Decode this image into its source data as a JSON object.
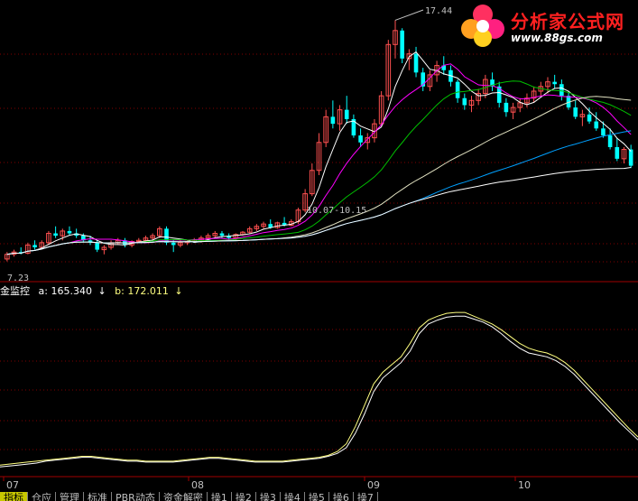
{
  "logo": {
    "title": "分析家公式网",
    "url": "www.88gs.com"
  },
  "indicator": {
    "name": "金监控",
    "a_label": "a:",
    "a_value": "165.340",
    "a_arrow": "↓",
    "b_label": "b:",
    "b_value": "172.011",
    "b_arrow": "↓"
  },
  "colors": {
    "up": "#ff5050",
    "down": "#00ffff",
    "ma_white": "#ffffff",
    "ma_magenta": "#ff00ff",
    "ma_green": "#00c000",
    "ma_blue": "#00a0ff",
    "ma_beige": "#e0e0c0",
    "ind_a": "#ffffff",
    "ind_b": "#ffff80",
    "grid": "#800000"
  },
  "bottom_tabs": [
    "指标",
    "仓应",
    "管理",
    "标准",
    "PBR动态",
    "资金解密",
    "操1",
    "操2",
    "操3",
    "操4",
    "操5",
    "操6",
    "操7"
  ],
  "active_tab": 0,
  "chart_data": {
    "type": "candlestick",
    "x_ticks": [
      "07",
      "08",
      "09",
      "10"
    ],
    "annotations": {
      "high": "17.44",
      "low": "7.23",
      "range": "10.07-10.15"
    },
    "price_ylim": [
      6.5,
      18.0
    ],
    "candles": [
      [
        7.2,
        7.5,
        7.1,
        7.4
      ],
      [
        7.4,
        7.6,
        7.3,
        7.5
      ],
      [
        7.5,
        7.7,
        7.4,
        7.45
      ],
      [
        7.45,
        7.9,
        7.4,
        7.8
      ],
      [
        7.8,
        8.0,
        7.6,
        7.7
      ],
      [
        7.7,
        8.0,
        7.6,
        7.9
      ],
      [
        7.9,
        8.4,
        7.8,
        8.3
      ],
      [
        8.3,
        8.6,
        8.1,
        8.2
      ],
      [
        8.2,
        8.5,
        8.0,
        8.4
      ],
      [
        8.4,
        8.6,
        8.2,
        8.3
      ],
      [
        8.3,
        8.5,
        8.1,
        8.2
      ],
      [
        8.2,
        8.3,
        7.9,
        8.0
      ],
      [
        8.0,
        8.2,
        7.8,
        7.9
      ],
      [
        7.9,
        8.0,
        7.5,
        7.6
      ],
      [
        7.6,
        7.8,
        7.4,
        7.7
      ],
      [
        7.7,
        8.0,
        7.6,
        7.9
      ],
      [
        7.9,
        8.1,
        7.8,
        8.0
      ],
      [
        8.0,
        8.1,
        7.7,
        7.8
      ],
      [
        7.8,
        8.0,
        7.7,
        7.95
      ],
      [
        7.95,
        8.1,
        7.9,
        8.0
      ],
      [
        8.0,
        8.2,
        7.9,
        8.1
      ],
      [
        8.1,
        8.3,
        8.0,
        8.2
      ],
      [
        8.2,
        8.6,
        8.1,
        8.5
      ],
      [
        8.5,
        8.6,
        7.8,
        7.9
      ],
      [
        7.9,
        8.0,
        7.5,
        7.8
      ],
      [
        7.8,
        8.0,
        7.7,
        7.9
      ],
      [
        7.9,
        8.0,
        7.8,
        7.95
      ],
      [
        7.95,
        8.1,
        7.9,
        8.0
      ],
      [
        8.0,
        8.2,
        7.9,
        8.1
      ],
      [
        8.1,
        8.3,
        8.0,
        8.2
      ],
      [
        8.2,
        8.4,
        8.1,
        8.3
      ],
      [
        8.3,
        8.4,
        8.1,
        8.2
      ],
      [
        8.2,
        8.3,
        8.0,
        8.1
      ],
      [
        8.1,
        8.3,
        8.0,
        8.25
      ],
      [
        8.25,
        8.4,
        8.2,
        8.35
      ],
      [
        8.35,
        8.6,
        8.3,
        8.5
      ],
      [
        8.5,
        8.7,
        8.4,
        8.6
      ],
      [
        8.6,
        8.8,
        8.5,
        8.7
      ],
      [
        8.7,
        8.9,
        8.5,
        8.55
      ],
      [
        8.55,
        8.8,
        8.5,
        8.75
      ],
      [
        8.75,
        9.0,
        8.6,
        8.65
      ],
      [
        8.65,
        8.9,
        8.6,
        8.8
      ],
      [
        8.8,
        9.4,
        8.7,
        9.3
      ],
      [
        9.3,
        10.2,
        9.2,
        10.0
      ],
      [
        10.0,
        11.3,
        9.9,
        11.0
      ],
      [
        11.0,
        12.6,
        10.8,
        12.2
      ],
      [
        12.2,
        13.6,
        12.0,
        13.3
      ],
      [
        13.3,
        14.0,
        12.8,
        13.0
      ],
      [
        13.0,
        13.8,
        12.7,
        13.6
      ],
      [
        13.6,
        14.2,
        13.0,
        13.2
      ],
      [
        13.2,
        13.4,
        12.4,
        12.5
      ],
      [
        12.5,
        12.8,
        12.0,
        12.2
      ],
      [
        12.2,
        12.6,
        11.9,
        12.4
      ],
      [
        12.4,
        13.2,
        12.2,
        13.0
      ],
      [
        13.0,
        14.4,
        12.9,
        14.2
      ],
      [
        14.2,
        16.6,
        14.0,
        16.4
      ],
      [
        16.4,
        17.44,
        15.8,
        17.0
      ],
      [
        17.0,
        17.1,
        15.6,
        15.8
      ],
      [
        15.8,
        16.2,
        15.3,
        16.0
      ],
      [
        16.0,
        16.3,
        15.0,
        15.2
      ],
      [
        15.2,
        15.4,
        14.4,
        14.6
      ],
      [
        14.6,
        15.3,
        14.4,
        15.1
      ],
      [
        15.1,
        15.7,
        14.8,
        15.5
      ],
      [
        15.5,
        15.9,
        15.1,
        15.3
      ],
      [
        15.3,
        15.5,
        14.6,
        14.8
      ],
      [
        14.8,
        14.9,
        13.9,
        14.1
      ],
      [
        14.1,
        14.3,
        13.6,
        13.8
      ],
      [
        13.8,
        14.2,
        13.5,
        14.0
      ],
      [
        14.0,
        14.5,
        13.8,
        14.3
      ],
      [
        14.3,
        15.1,
        14.1,
        14.9
      ],
      [
        14.9,
        15.2,
        14.4,
        14.6
      ],
      [
        14.6,
        14.8,
        13.7,
        13.9
      ],
      [
        13.9,
        14.1,
        13.3,
        13.5
      ],
      [
        13.5,
        13.9,
        13.2,
        13.7
      ],
      [
        13.7,
        14.1,
        13.5,
        13.9
      ],
      [
        13.9,
        14.3,
        13.7,
        14.1
      ],
      [
        14.1,
        14.6,
        13.9,
        14.4
      ],
      [
        14.4,
        14.8,
        14.2,
        14.6
      ],
      [
        14.6,
        15.0,
        14.3,
        14.8
      ],
      [
        14.8,
        15.1,
        14.5,
        14.7
      ],
      [
        14.7,
        14.9,
        14.0,
        14.2
      ],
      [
        14.2,
        14.4,
        13.6,
        13.7
      ],
      [
        13.7,
        14.0,
        13.2,
        13.3
      ],
      [
        13.3,
        13.6,
        12.9,
        13.4
      ],
      [
        13.4,
        13.7,
        13.0,
        13.1
      ],
      [
        13.1,
        13.5,
        12.7,
        12.8
      ],
      [
        12.8,
        13.1,
        12.4,
        12.5
      ],
      [
        12.5,
        12.8,
        11.9,
        12.0
      ],
      [
        12.0,
        12.4,
        11.4,
        11.5
      ],
      [
        11.5,
        12.0,
        11.3,
        11.9
      ],
      [
        11.9,
        12.1,
        11.1,
        11.2
      ]
    ],
    "indicator_ylim": [
      0,
      185
    ],
    "series": [
      {
        "name": "a",
        "values": [
          10,
          11,
          12,
          13,
          14,
          16,
          17,
          18,
          19,
          20,
          20,
          19,
          18,
          17,
          16,
          16,
          15,
          15,
          15,
          15,
          16,
          17,
          18,
          19,
          19,
          18,
          17,
          16,
          15,
          15,
          15,
          15,
          16,
          17,
          18,
          19,
          21,
          24,
          30,
          45,
          65,
          88,
          102,
          110,
          118,
          130,
          148,
          158,
          162,
          165,
          166,
          166,
          163,
          160,
          155,
          148,
          140,
          133,
          128,
          126,
          124,
          120,
          114,
          106,
          96,
          86,
          76,
          66,
          56,
          47,
          38
        ]
      },
      {
        "name": "b",
        "values": [
          12,
          13,
          14,
          15,
          16,
          17,
          18,
          19,
          20,
          21,
          21,
          20,
          19,
          18,
          17,
          17,
          16,
          16,
          16,
          16,
          17,
          18,
          19,
          20,
          20,
          19,
          18,
          17,
          16,
          16,
          16,
          16,
          17,
          18,
          19,
          20,
          22,
          26,
          34,
          52,
          74,
          96,
          108,
          116,
          124,
          138,
          154,
          162,
          166,
          169,
          170,
          170,
          166,
          162,
          158,
          152,
          145,
          138,
          133,
          130,
          128,
          124,
          118,
          110,
          100,
          90,
          80,
          70,
          60,
          50,
          41
        ]
      }
    ]
  }
}
